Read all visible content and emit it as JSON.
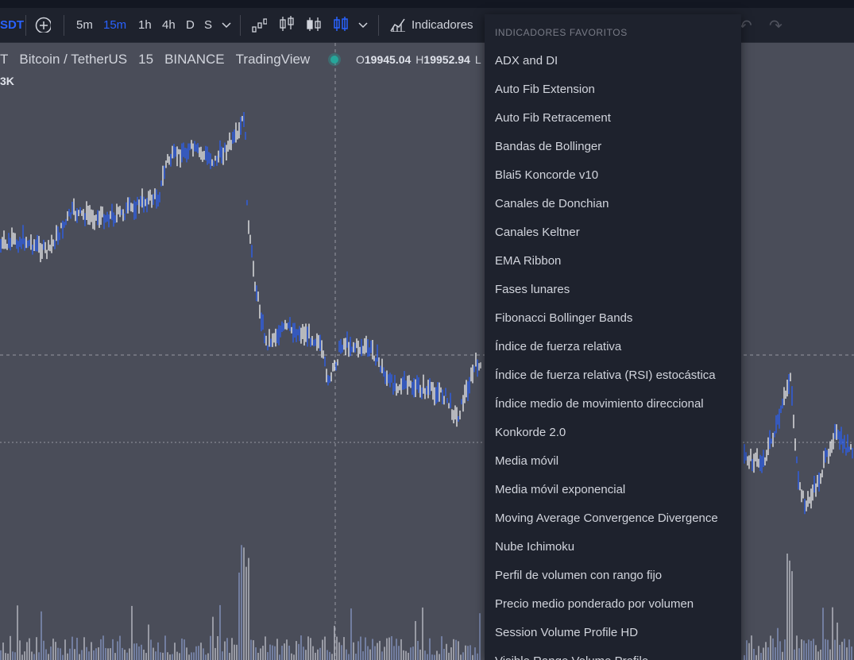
{
  "toolbar": {
    "symbol": "SDT",
    "intervals": [
      "5m",
      "15m",
      "1h",
      "4h",
      "D",
      "S"
    ],
    "active_interval": "15m",
    "indicators_label": "Indicadores"
  },
  "legend": {
    "symbol_fragment": "T",
    "pair": "Bitcoin / TetherUS",
    "interval": "15",
    "exchange": "BINANCE",
    "source": "TradingView",
    "open_label": "O",
    "open_value": "19945.04",
    "high_label": "H",
    "high_value": "19952.94",
    "low_label": "L",
    "sub_fragment": "3K"
  },
  "menu": {
    "header": "INDICADORES FAVORITOS",
    "items": [
      "ADX and DI",
      "Auto Fib Extension",
      "Auto Fib Retracement",
      "Bandas de Bollinger",
      "Blai5 Koncorde v10",
      "Canales de Donchian",
      "Canales Keltner",
      "EMA Ribbon",
      "Fases lunares",
      "Fibonacci Bollinger Bands",
      "Índice de fuerza relativa",
      "Índice de fuerza relativa (RSI) estocástica",
      "Índice medio de movimiento direccional",
      "Konkorde 2.0",
      "Media móvil",
      "Media móvil exponencial",
      "Moving Average Convergence Divergence",
      "Nube Ichimoku",
      "Perfil de volumen con rango fijo",
      "Precio medio ponderado por volumen",
      "Session Volume Profile HD",
      "Visible Range Volume Profile"
    ]
  },
  "colors": {
    "background": "#4a4d59",
    "panel": "#1e222d",
    "accent": "#2962ff",
    "candle_up": "#ffffff",
    "candle_down": "#2962ff",
    "live_dot": "#26a69a"
  },
  "icons": [
    "plus-circle-icon",
    "bar-style-icon",
    "candles-icon",
    "hollow-candles-icon",
    "columns-icon",
    "chevron-down-icon",
    "indicators-icon",
    "undo-icon",
    "redo-icon"
  ]
}
